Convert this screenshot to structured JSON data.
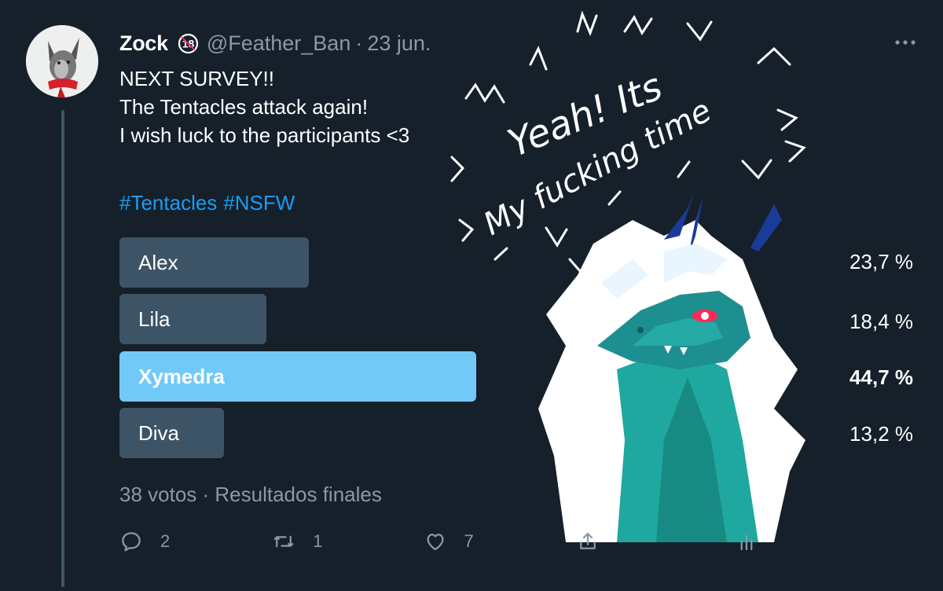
{
  "tweet": {
    "display_name": "Zock",
    "age_badge": "18",
    "handle": "@Feather_Ban",
    "separator": "·",
    "date": "23 jun.",
    "text": "NEXT SURVEY!!\nThe Tentacles attack again!\nI wish luck to the participants <3",
    "hashtags": [
      "#Tentacles",
      "#NSFW"
    ]
  },
  "poll": {
    "options": [
      {
        "label": "Alex",
        "percent": "23,7 %",
        "value": 23.7,
        "winner": false
      },
      {
        "label": "Lila",
        "percent": "18,4 %",
        "value": 18.4,
        "winner": false
      },
      {
        "label": "Xymedra",
        "percent": "44,7 %",
        "value": 44.7,
        "winner": true
      },
      {
        "label": "Diva",
        "percent": "13,2 %",
        "value": 13.2,
        "winner": false
      }
    ],
    "meta": "38 votos · Resultados finales"
  },
  "actions": {
    "reply_count": "2",
    "retweet_count": "1",
    "like_count": "7"
  },
  "sticker": {
    "text_line1": "Yeah! Its",
    "text_line2": "My fucking time"
  },
  "colors": {
    "background": "#15202b",
    "accent": "#1d9bf0",
    "poll_bar": "#3d5466",
    "poll_winner": "#71c9f8",
    "muted": "#8b98a5"
  }
}
